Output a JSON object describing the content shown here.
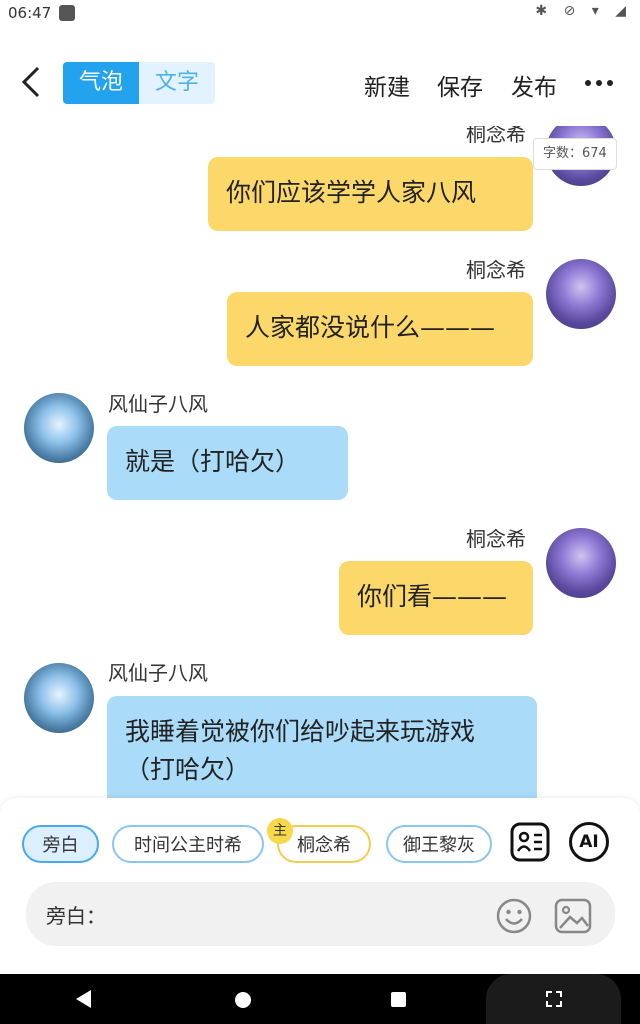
{
  "status": {
    "time": "06:47"
  },
  "toolbar": {
    "tab_bubble": "气泡",
    "tab_text": "文字",
    "new_label": "新建",
    "save_label": "保存",
    "publish_label": "发布"
  },
  "chat": {
    "word_count": "字数：674",
    "messages": [
      {
        "name": "桐念希",
        "text": "你们应该学学人家八风"
      },
      {
        "name": "桐念希",
        "text": "人家都没说什么———"
      },
      {
        "name": "风仙子八风",
        "text": "就是（打哈欠）"
      },
      {
        "name": "桐念希",
        "text": "你们看———"
      },
      {
        "name": "风仙子八风",
        "text": "我睡着觉被你们给吵起来玩游戏（打哈欠）"
      }
    ]
  },
  "roles": {
    "narration": "旁白",
    "items": [
      "时间公主时希",
      "桐念希",
      "御王黎灰"
    ],
    "main_badge": "主",
    "ai_label": "AI"
  },
  "input": {
    "prefix": "旁白："
  }
}
